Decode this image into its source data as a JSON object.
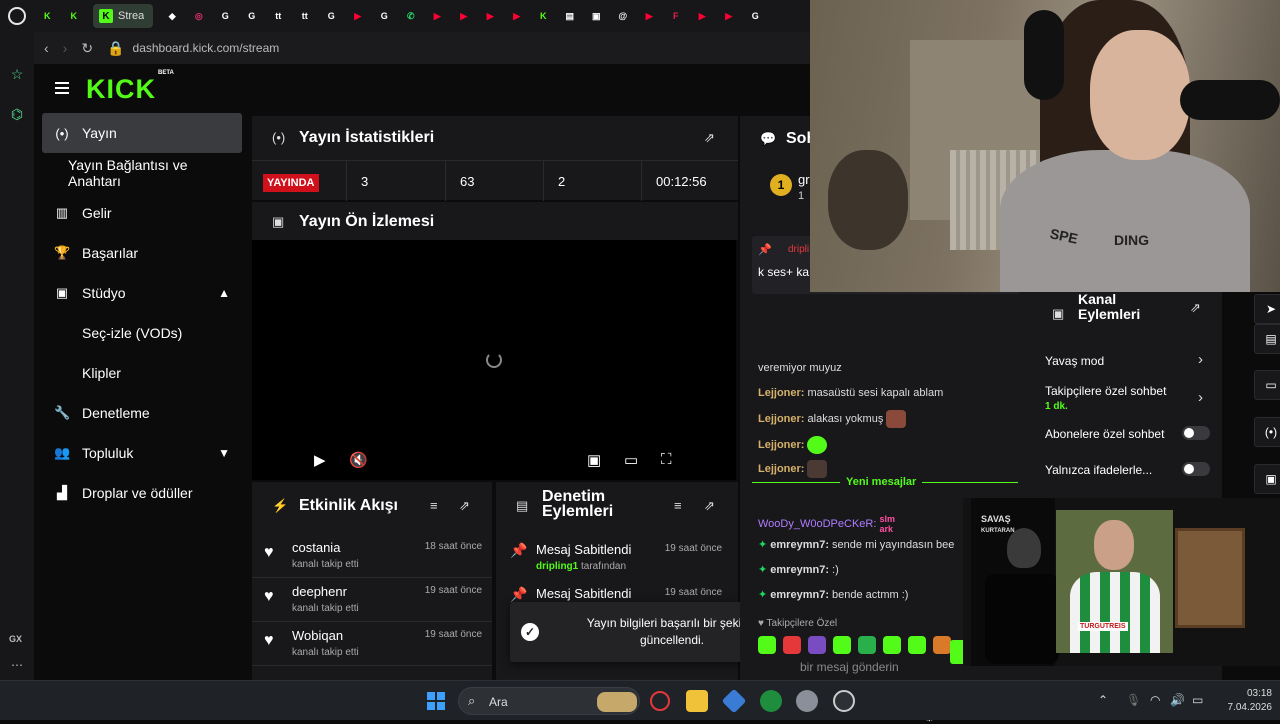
{
  "browser": {
    "active_tab_label": "Strea",
    "url": "dashboard.kick.com/stream",
    "tab_icons": [
      {
        "name": "kick-icon",
        "color": "#53fc18",
        "glyph": "K"
      },
      {
        "name": "kick-icon",
        "color": "#53fc18",
        "glyph": "K"
      },
      {
        "name": "codepen-icon",
        "color": "#ffffff",
        "glyph": "◆"
      },
      {
        "name": "instagram-icon",
        "color": "#e1306c",
        "glyph": "◎"
      },
      {
        "name": "google-icon",
        "color": "#ffffff",
        "glyph": "G"
      },
      {
        "name": "google-icon",
        "color": "#ffffff",
        "glyph": "G"
      },
      {
        "name": "tiktok-icon",
        "color": "#ffffff",
        "glyph": "tt"
      },
      {
        "name": "tiktok-icon",
        "color": "#ffffff",
        "glyph": "tt"
      },
      {
        "name": "google-icon",
        "color": "#ffffff",
        "glyph": "G"
      },
      {
        "name": "youtube-icon",
        "color": "#ff0033",
        "glyph": "▶"
      },
      {
        "name": "google-icon",
        "color": "#ffffff",
        "glyph": "G"
      },
      {
        "name": "whatsapp-icon",
        "color": "#25d366",
        "glyph": "✆"
      },
      {
        "name": "youtube-icon",
        "color": "#ff0033",
        "glyph": "▶"
      },
      {
        "name": "youtube-icon",
        "color": "#ff0033",
        "glyph": "▶"
      },
      {
        "name": "youtube-icon",
        "color": "#ff0033",
        "glyph": "▶"
      },
      {
        "name": "youtube-icon",
        "color": "#ff0033",
        "glyph": "▶"
      },
      {
        "name": "kick-icon",
        "color": "#53fc18",
        "glyph": "K"
      },
      {
        "name": "doc-icon",
        "color": "#ffffff",
        "glyph": "▤"
      },
      {
        "name": "app-icon",
        "color": "#ffffff",
        "glyph": "▣"
      },
      {
        "name": "threads-icon",
        "color": "#ffffff",
        "glyph": "@"
      },
      {
        "name": "youtube-icon",
        "color": "#ff0033",
        "glyph": "▶"
      },
      {
        "name": "f-icon",
        "color": "#e02050",
        "glyph": "F"
      },
      {
        "name": "youtube-icon",
        "color": "#ff0033",
        "glyph": "▶"
      },
      {
        "name": "youtube-icon",
        "color": "#ff0033",
        "glyph": "▶"
      },
      {
        "name": "google-icon",
        "color": "#ffffff",
        "glyph": "G"
      }
    ],
    "sidebar_bottom": "GX"
  },
  "logo": {
    "text": "KICK",
    "badge": "BETA"
  },
  "nav": {
    "items": [
      {
        "label": "Yayın",
        "icon": "(•)"
      },
      {
        "label": "Yayın Bağlantısı ve Anahtarı",
        "icon": ""
      },
      {
        "label": "Gelir",
        "icon": "▥"
      },
      {
        "label": "Başarılar",
        "icon": "🏆"
      },
      {
        "label": "Stüdyo",
        "icon": "▣"
      },
      {
        "label": "Seç-izle (VODs)",
        "icon": ""
      },
      {
        "label": "Klipler",
        "icon": ""
      },
      {
        "label": "Denetleme",
        "icon": "🔧"
      },
      {
        "label": "Topluluk",
        "icon": "👥"
      },
      {
        "label": "Droplar ve ödüller",
        "icon": "▟"
      }
    ]
  },
  "stats": {
    "title": "Yayın İstatistikleri",
    "status": "YAYINDA",
    "values": [
      "3",
      "63",
      "2",
      "00:12:56"
    ]
  },
  "preview": {
    "title": "Yayın Ön İzlemesi"
  },
  "activity": {
    "title": "Etkinlik Akışı",
    "items": [
      {
        "name": "costania",
        "action": "kanalı takip etti",
        "time": "18 saat önce"
      },
      {
        "name": "deephenr",
        "action": "kanalı takip etti",
        "time": "19 saat önce"
      },
      {
        "name": "Wobiqan",
        "action": "kanalı takip etti",
        "time": "19 saat önce"
      }
    ]
  },
  "moderation": {
    "title_line1": "Denetim",
    "title_line2": "Eylemleri",
    "items": [
      {
        "title": "Mesaj Sabitlendi",
        "by_user": "dripling1",
        "by_suffix": " tarafından",
        "time": "19 saat önce"
      },
      {
        "title": "Mesaj Sabitlendi",
        "by_user": "",
        "by_suffix": "",
        "time": "19 saat önce"
      }
    ]
  },
  "toast": {
    "message": "Yayın bilgileri başarılı bir şekilde güncellendi."
  },
  "chat": {
    "title": "Soh",
    "top_user": "gr",
    "top_count": "1",
    "pinned_user": "dripli",
    "pinned_text": "k ses+ ka",
    "lines": [
      {
        "user": "",
        "text": "veremiyor muyuz"
      },
      {
        "user": "Lejjoner:",
        "text": " masaüstü sesi kapalı ablam"
      },
      {
        "user": "Lejjoner:",
        "text": " alakası yokmuş"
      },
      {
        "user": "Lejjoner:",
        "text": ""
      },
      {
        "user": "Lejjoner:",
        "text": ""
      }
    ],
    "new_messages_label": "Yeni mesajlar",
    "woody_user": "WooDy_W0oDPeCKeR:",
    "woody_emote": "slm ark",
    "emrey_lines": [
      {
        "user": "emreymn7:",
        "text": " sende mi yayındasın bee"
      },
      {
        "user": "emreymn7:",
        "text": " :)"
      },
      {
        "user": "emreymn7:",
        "text": " bende actmm :)"
      }
    ],
    "followers_label": "Takipçilere Özel",
    "input_placeholder": "bir mesaj gönderin"
  },
  "channel": {
    "title_line1": "Kanal",
    "title_line2": "Eylemleri",
    "slow_mode": "Yavaş mod",
    "followers_only": "Takipçilere özel sohbet",
    "followers_only_value": "1 dk.",
    "subscribers_only": "Abonelere özel sohbet",
    "emotes_only": "Yalnızca ifadelerle..."
  },
  "webcam": {
    "brand_left": "SPE",
    "brand_right": "DING"
  },
  "thumb": {
    "savas_line1": "SAVAŞ",
    "savas_line2": "KURTARAN",
    "sponsor": "TURGUTREIS"
  },
  "taskbar": {
    "search": "Ara",
    "time": "03:18",
    "date": "7.04.2026"
  },
  "colors": {
    "brand": "#53fc18",
    "live": "#d0101a",
    "panel": "#18181b"
  }
}
